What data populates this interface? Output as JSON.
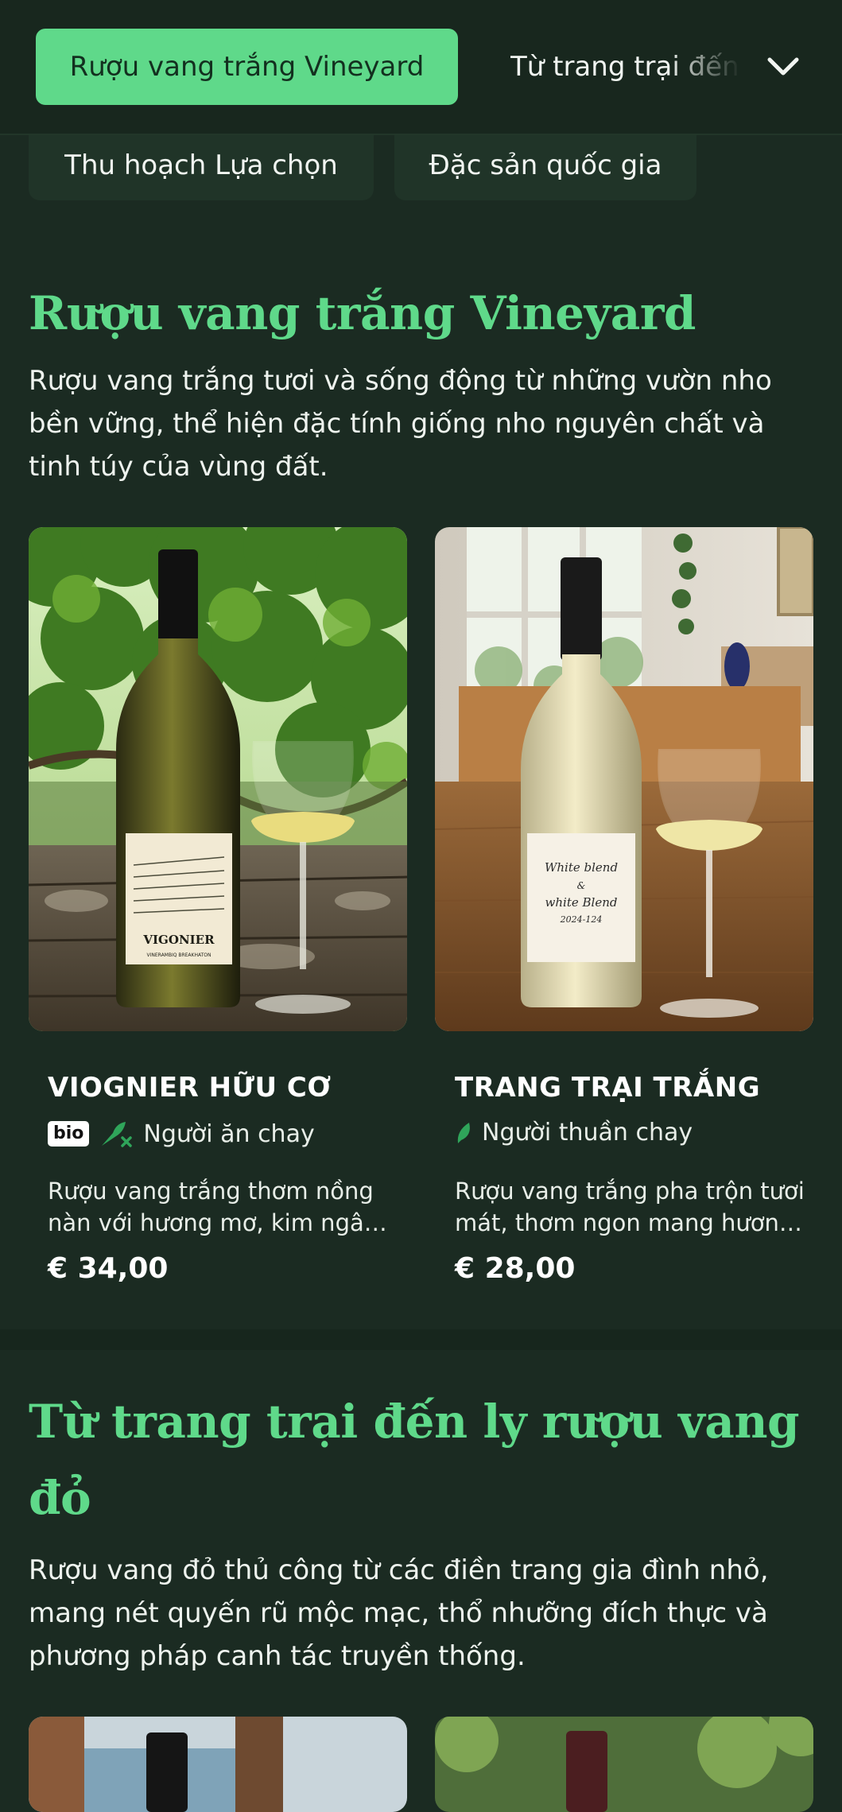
{
  "nav": {
    "active_tab": "Rượu vang trắng Vineyard",
    "next_tab": "Từ trang trại đến ly rượu vang đỏ",
    "chips": [
      "Thu hoạch Lựa chọn",
      "Đặc sản quốc gia"
    ],
    "expand_icon": "chevron-down-icon"
  },
  "section_white": {
    "title": "Rượu vang trắng Vineyard",
    "description": "Rượu vang trắng tươi và sống động từ những vườn nho bền vững, thể hiện đặc tính giống nho nguyên chất và tinh túy của vùng đất.",
    "products": [
      {
        "name": "VIOGNIER HỮU CƠ",
        "badge": "bio",
        "diet_icon": "vegetarian-icon",
        "diet": "Người ăn chay",
        "description": "Rượu vang trắng thơm nồng nàn với hương mơ, kim ngân hoa và đào trắng.",
        "price": "€ 34,00",
        "label_text": "VIGONIER",
        "label_subtext": "VINERAMBIQ BREAKHATON"
      },
      {
        "name": "TRANG TRẠI TRẮNG",
        "diet_icon": "leaf-icon",
        "diet": "Người thuần chay",
        "description": "Rượu vang trắng pha trộn tươi mát, thơm ngon mang hương vị trái cây.",
        "price": "€ 28,00",
        "label_line1": "White blend",
        "label_line2": "&",
        "label_line3": "white Blend",
        "label_line4": "2024-124"
      }
    ]
  },
  "section_red": {
    "title": "Từ trang trại đến ly rượu vang đỏ",
    "description": "Rượu vang đỏ thủ công từ các điền trang gia đình nhỏ, mang nét quyến rũ mộc mạc, thổ nhưỡng đích thực và phương pháp canh tác truyền thống."
  },
  "colors": {
    "background": "#1b2b22",
    "accent": "#5fd98a",
    "card": "#203428"
  }
}
